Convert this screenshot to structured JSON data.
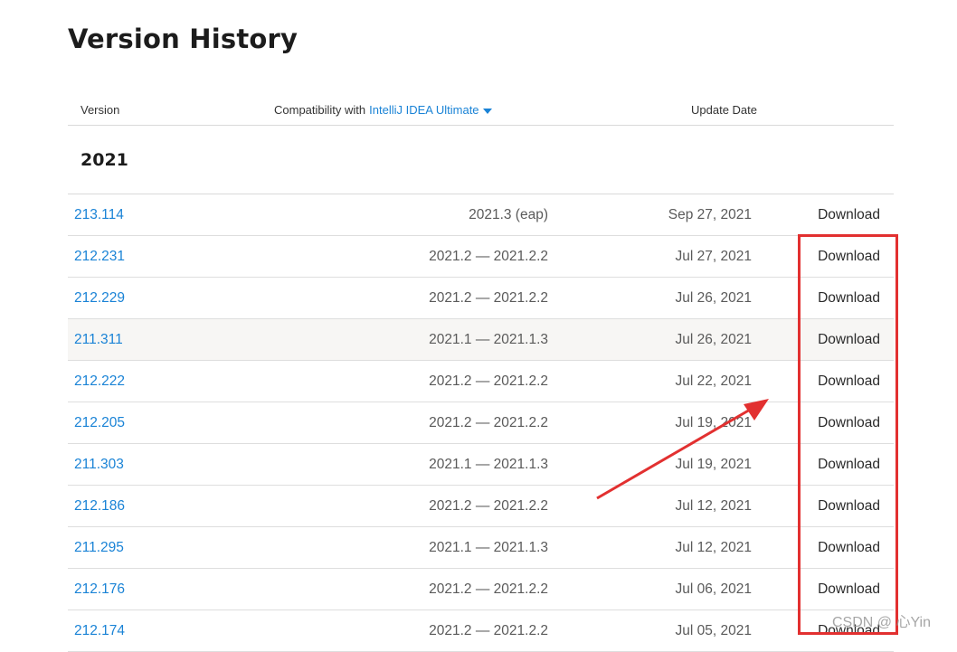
{
  "page": {
    "title": "Version History"
  },
  "table_header": {
    "version": "Version",
    "compat_prefix": "Compatibility with",
    "compat_product": "IntelliJ IDEA Ultimate",
    "update_date": "Update Date"
  },
  "year_group": "2021",
  "rows": [
    {
      "version": "213.114",
      "compat": "2021.3 (eap)",
      "date": "Sep 27, 2021",
      "download": "Download"
    },
    {
      "version": "212.231",
      "compat": "2021.2 — 2021.2.2",
      "date": "Jul 27, 2021",
      "download": "Download"
    },
    {
      "version": "212.229",
      "compat": "2021.2 — 2021.2.2",
      "date": "Jul 26, 2021",
      "download": "Download"
    },
    {
      "version": "211.311",
      "compat": "2021.1 — 2021.1.3",
      "date": "Jul 26, 2021",
      "download": "Download"
    },
    {
      "version": "212.222",
      "compat": "2021.2 — 2021.2.2",
      "date": "Jul 22, 2021",
      "download": "Download"
    },
    {
      "version": "212.205",
      "compat": "2021.2 — 2021.2.2",
      "date": "Jul 19, 2021",
      "download": "Download"
    },
    {
      "version": "211.303",
      "compat": "2021.1 — 2021.1.3",
      "date": "Jul 19, 2021",
      "download": "Download"
    },
    {
      "version": "212.186",
      "compat": "2021.2 — 2021.2.2",
      "date": "Jul 12, 2021",
      "download": "Download"
    },
    {
      "version": "211.295",
      "compat": "2021.1 — 2021.1.3",
      "date": "Jul 12, 2021",
      "download": "Download"
    },
    {
      "version": "212.176",
      "compat": "2021.2 — 2021.2.2",
      "date": "Jul 06, 2021",
      "download": "Download"
    },
    {
      "version": "212.174",
      "compat": "2021.2 — 2021.2.2",
      "date": "Jul 05, 2021",
      "download": "Download"
    }
  ],
  "highlighted_row": "211.311",
  "watermark": "CSDN @ 心Yin",
  "colors": {
    "link": "#1a83d6",
    "annotation": "#e23030",
    "row_highlight": "#f7f6f4"
  }
}
